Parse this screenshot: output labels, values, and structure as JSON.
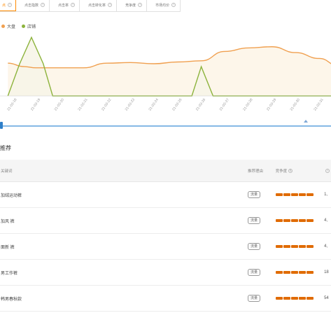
{
  "tabs": [
    {
      "label": "点",
      "active": true
    },
    {
      "label": "点击指数",
      "active": false
    },
    {
      "label": "点击率",
      "active": false
    },
    {
      "label": "点击转化率",
      "active": false
    },
    {
      "label": "竞争度",
      "active": false
    },
    {
      "label": "市场均价",
      "active": false
    }
  ],
  "legend": [
    {
      "label": "大盘",
      "color": "#f0a050"
    },
    {
      "label": "店铺",
      "color": "#8cb33c"
    }
  ],
  "chart_data": {
    "type": "line",
    "categories": [
      "21-03-18",
      "21-03-19",
      "21-03-20",
      "21-03-21",
      "21-03-22",
      "21-03-23",
      "21-03-24",
      "21-03-25",
      "21-03-26",
      "21-03-27",
      "21-03-28",
      "21-03-29",
      "21-03-30",
      "21-03-31",
      "21-04-01"
    ],
    "x_start_offset": -0.2,
    "x_end_offset": 0.2,
    "series": [
      {
        "name": "大盘",
        "color": "#f0a050",
        "fill": "#fdf5e8",
        "points": [
          [
            -0.2,
            56
          ],
          [
            0.5,
            50
          ],
          [
            1,
            48
          ],
          [
            2,
            48
          ],
          [
            3,
            48
          ],
          [
            4,
            56
          ],
          [
            5,
            57
          ],
          [
            6,
            55
          ],
          [
            7,
            58
          ],
          [
            8,
            60
          ],
          [
            9,
            76
          ],
          [
            10,
            82
          ],
          [
            11,
            84
          ],
          [
            12,
            74
          ],
          [
            13,
            64
          ],
          [
            13.8,
            52
          ]
        ]
      },
      {
        "name": "店铺",
        "color": "#8cb33c",
        "fill": "#f7f5e8",
        "points": [
          [
            -0.2,
            0
          ],
          [
            0.3,
            55
          ],
          [
            0.8,
            100
          ],
          [
            1.3,
            55
          ],
          [
            1.7,
            0
          ],
          [
            2,
            0
          ],
          [
            3,
            0
          ],
          [
            4,
            0
          ],
          [
            5,
            0
          ],
          [
            6,
            0
          ],
          [
            7,
            0
          ],
          [
            7.6,
            0
          ],
          [
            8,
            50
          ],
          [
            8.5,
            0
          ],
          [
            9,
            0
          ],
          [
            10,
            0
          ],
          [
            11,
            0
          ],
          [
            12,
            0
          ],
          [
            13,
            0
          ],
          [
            13.8,
            0
          ]
        ]
      }
    ],
    "ylim": [
      0,
      110
    ],
    "grid": false,
    "legend_position": "top-left"
  },
  "section_title": "推荐",
  "table": {
    "headers": {
      "keyword": "关键词",
      "tag": "推荐理由",
      "competition": "竞争度",
      "number": "点"
    },
    "rows": [
      {
        "keyword": "加绒运动裤",
        "tag": "流量",
        "competition": 5,
        "number": "1,"
      },
      {
        "keyword": "加风 裤",
        "tag": "流量",
        "competition": 5,
        "number": "4,"
      },
      {
        "keyword": "面新 裤",
        "tag": "流量",
        "competition": 5,
        "number": "4,"
      },
      {
        "keyword": "男工作裤",
        "tag": "流量",
        "competition": 5,
        "number": "18"
      },
      {
        "keyword": "韩男春秋款",
        "tag": "流量",
        "competition": 5,
        "number": "54"
      }
    ]
  }
}
